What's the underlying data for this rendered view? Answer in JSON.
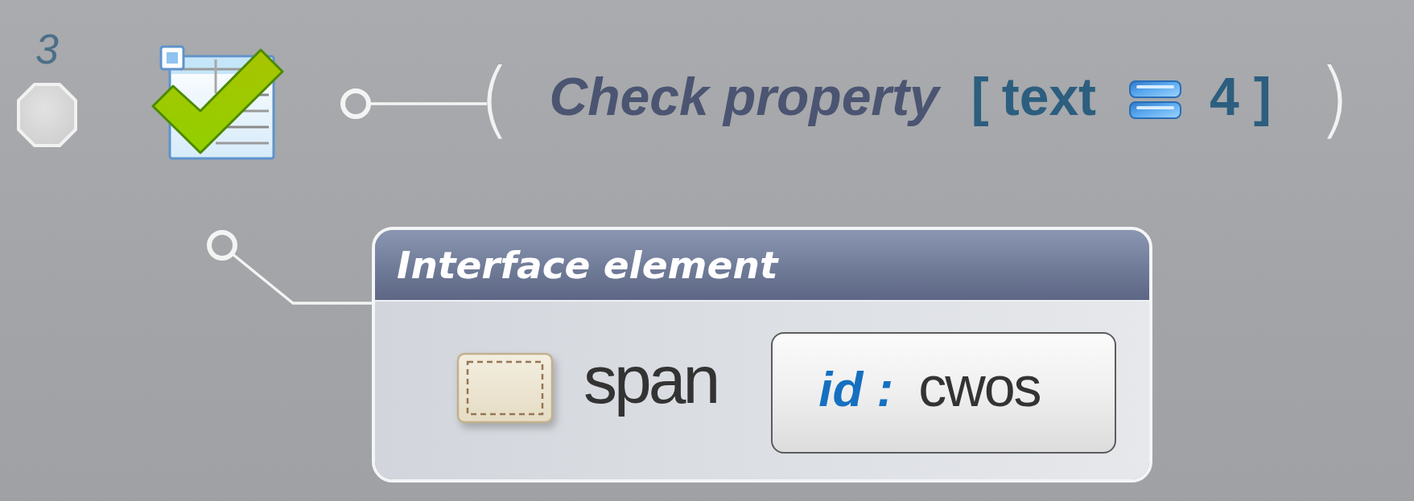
{
  "step": {
    "number": "3",
    "open_paren": "(",
    "action": "Check property",
    "condition": {
      "open_bracket": "[",
      "property": "text",
      "value": "4",
      "close_bracket": "]"
    },
    "close_paren": ")"
  },
  "element": {
    "title": "Interface element",
    "tag": "span",
    "attributes": [
      {
        "name": "id :",
        "value": "cwos"
      }
    ]
  }
}
